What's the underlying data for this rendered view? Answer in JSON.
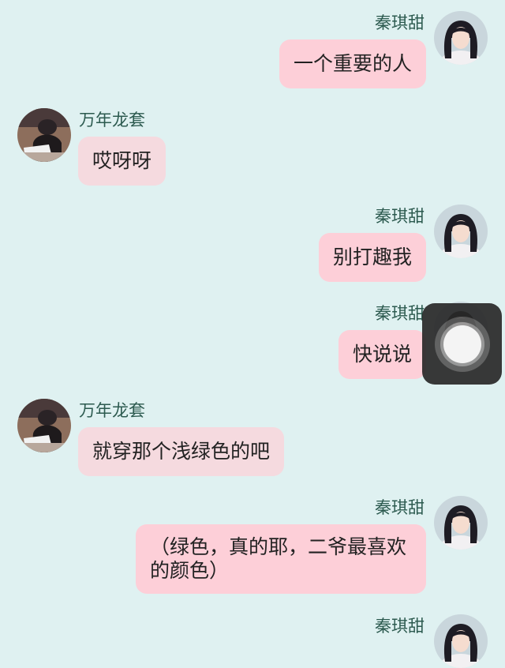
{
  "chat": {
    "messages": [
      {
        "sender": "秦琪甜",
        "side": "right",
        "text": "一个重要的人"
      },
      {
        "sender": "万年龙套",
        "side": "left",
        "text": "哎呀呀"
      },
      {
        "sender": "秦琪甜",
        "side": "right",
        "text": "别打趣我"
      },
      {
        "sender": "秦琪甜",
        "side": "right",
        "text": "快说说"
      },
      {
        "sender": "万年龙套",
        "side": "left",
        "text": "就穿那个浅绿色的吧"
      },
      {
        "sender": "秦琪甜",
        "side": "right",
        "text": "（绿色，真的耶，二爷最喜欢的颜色）"
      },
      {
        "sender": "秦琪甜",
        "side": "right",
        "text": ""
      }
    ]
  },
  "colors": {
    "background": "#dff1f1",
    "right_bubble": "#fdcfd8",
    "left_bubble": "#f5dadf",
    "name_text": "#2c5a4f"
  },
  "icons": {
    "right_avatar": "girl-portrait-avatar",
    "left_avatar": "desk-photo-avatar",
    "assistive_touch": "assistive-touch-button"
  }
}
